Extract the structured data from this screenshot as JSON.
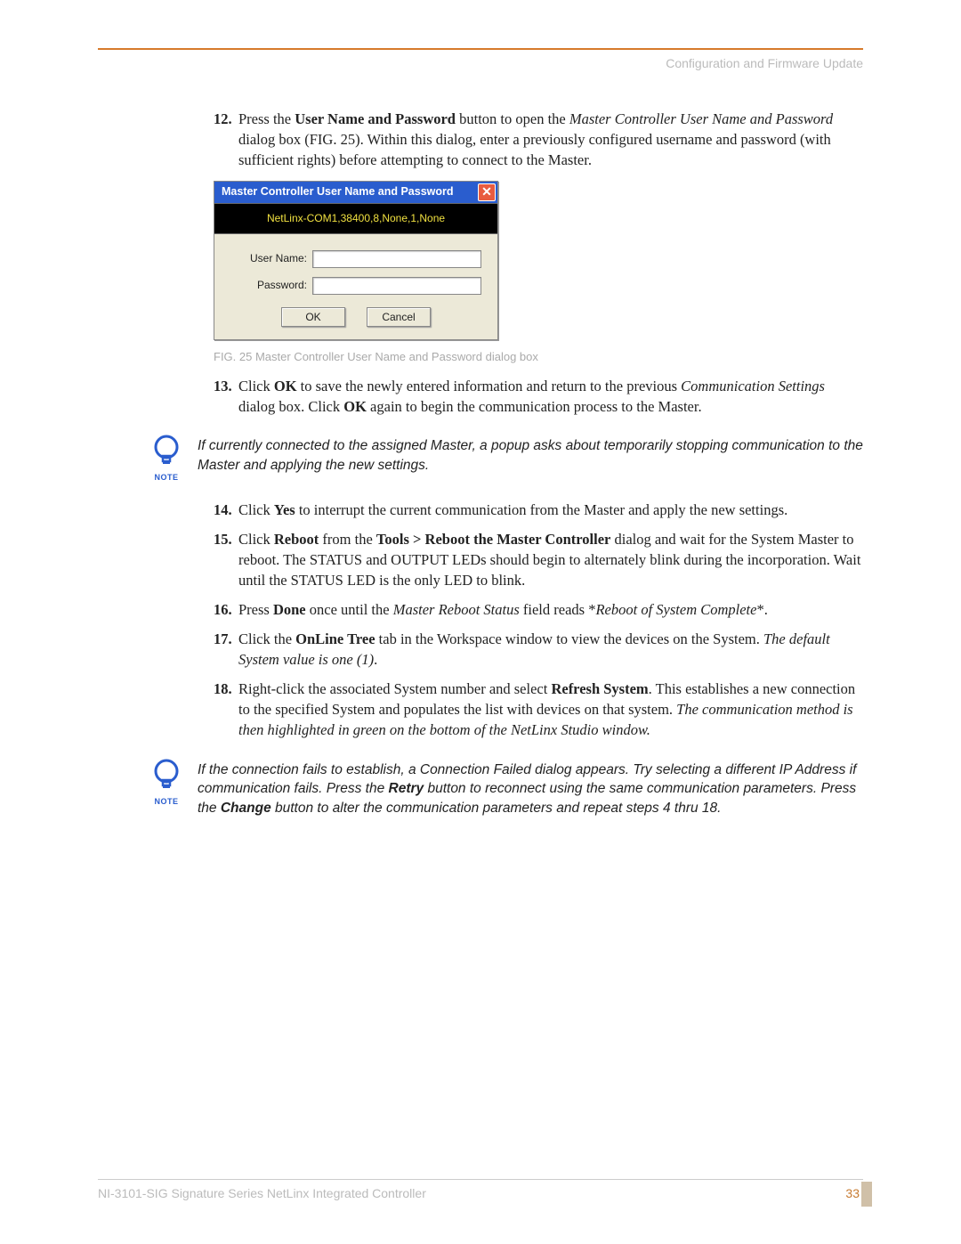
{
  "header": {
    "section": "Configuration and Firmware Update"
  },
  "steps_a": [
    {
      "num": "12.",
      "html": "Press the <b>User Name and Password</b> button to open the <i>Master Controller User Name and Password</i> dialog box (FIG. 25). Within this dialog, enter a previously configured username and password (with sufficient rights) before attempting to connect to the Master."
    }
  ],
  "dialog": {
    "title": "Master Controller User Name and Password",
    "conn": "NetLinx-COM1,38400,8,None,1,None",
    "user_label": "User Name:",
    "pass_label": "Password:",
    "ok": "OK",
    "cancel": "Cancel"
  },
  "fig_caption": "FIG. 25  Master Controller User Name and Password dialog box",
  "step13": {
    "num": "13.",
    "html": "Click <b>OK</b> to save the newly entered information and return to the previous <i>Communication Settings</i> dialog box. Click <b>OK</b> again to begin the communication process to the Master."
  },
  "note1": "If currently connected to the assigned Master, a popup asks about temporarily stopping communication to the Master and applying the new settings.",
  "steps_b": [
    {
      "num": "14.",
      "html": "Click <b>Yes</b> to interrupt the current communication from the Master and apply the new settings."
    },
    {
      "num": "15.",
      "html": "Click <b>Reboot</b> from the <b>Tools &gt; Reboot the Master Controller</b> dialog and wait for the System Master to reboot. The STATUS and OUTPUT LEDs should begin to alternately blink during the incorporation. Wait until the STATUS LED is the only LED to blink."
    },
    {
      "num": "16.",
      "html": "Press <b>Done</b> once until the <i>Master Reboot Status</i> field reads *<i>Reboot of System Complete</i>*."
    },
    {
      "num": "17.",
      "html": "Click the <b>OnLine Tree</b> tab in the Workspace window to view the devices on the System. <i>The default System value is one (1)</i>."
    },
    {
      "num": "18.",
      "html": "Right-click the associated System number and select <b>Refresh System</b>. This establishes a new connection to the specified System and populates the list with devices on that system. <i>The communication method is then highlighted in green on the bottom of the NetLinx Studio window.</i>"
    }
  ],
  "note2": "If the connection fails to establish, a Connection Failed dialog appears. Try selecting a different IP Address if communication fails. Press the <b>Retry</b> button to reconnect using the same communication parameters. Press the <b>Change</b> button to alter the communication parameters and repeat steps 4 thru 18.",
  "note_label": "NOTE",
  "footer": {
    "text": "NI-3101-SIG Signature Series NetLinx Integrated Controller",
    "page": "33"
  }
}
